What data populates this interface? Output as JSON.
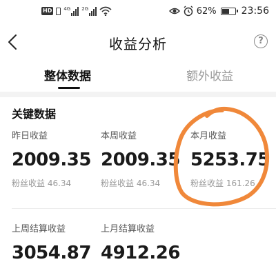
{
  "status_bar": {
    "hd": "HD",
    "net1": "4G",
    "net2": "2G",
    "battery_pct": "62%",
    "time": "23:56",
    "battery_level": 0.62
  },
  "header": {
    "title": "收益分析",
    "help": "?"
  },
  "tabs": [
    {
      "label": "整体数据",
      "active": true
    },
    {
      "label": "额外收益",
      "active": false
    }
  ],
  "section": {
    "title": "关键数据"
  },
  "metrics": [
    {
      "label": "昨日收益",
      "value": "2009.35",
      "sub": "粉丝收益 46.34"
    },
    {
      "label": "本周收益",
      "value": "2009.35",
      "sub": "粉丝收益 46.34"
    },
    {
      "label": "本月收益",
      "value": "5253.75",
      "sub": "粉丝收益 161.26"
    },
    {
      "label": "上周结算收益",
      "value": "3054.87"
    },
    {
      "label": "上月结算收益",
      "value": "4912.26"
    }
  ],
  "colors": {
    "annotation": "#f0883a"
  }
}
